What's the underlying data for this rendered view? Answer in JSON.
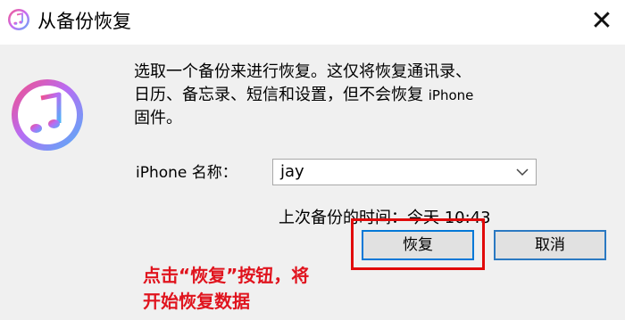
{
  "window": {
    "title": "从备份恢复",
    "close_glyph": "✕",
    "title_icon": "itunes-icon"
  },
  "message": {
    "app_icon": "itunes-icon",
    "lines": [
      {
        "text": "选取一个备份来进行恢复。这仅将恢复通讯录、"
      },
      {
        "text": "日历、备忘录、短信和设置，但不会恢复",
        "small": "iPhone"
      },
      {
        "text": "固件。"
      }
    ]
  },
  "device": {
    "label": "iPhone 名称：",
    "selected": "jay"
  },
  "last_backup": "上次备份的时间：今天 10:43",
  "annotation": {
    "line1": "点击“恢复”按钮，将",
    "line2": "开始恢复数据",
    "color": "#e0141e"
  },
  "buttons": {
    "restore": "恢复",
    "cancel": "取消"
  }
}
